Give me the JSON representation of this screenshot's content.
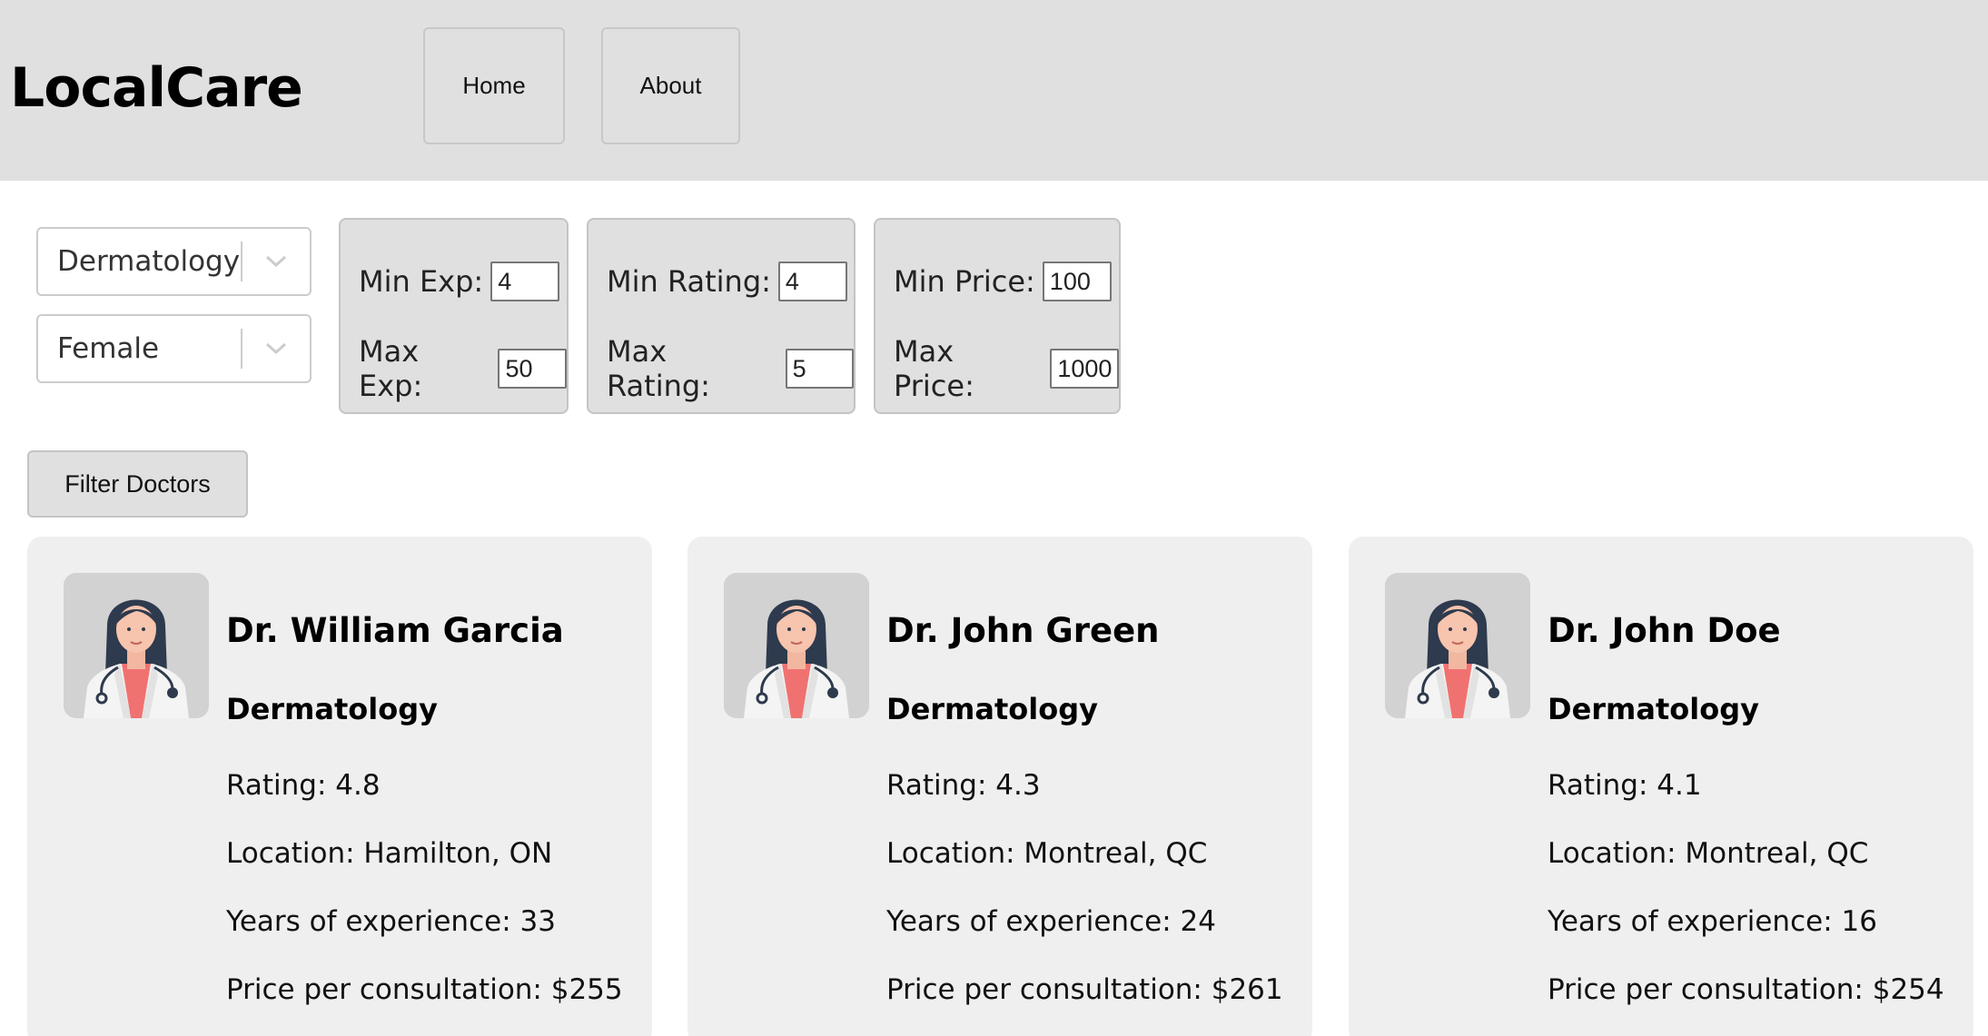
{
  "app": {
    "title": "LocalCare"
  },
  "nav": {
    "home": "Home",
    "about": "About"
  },
  "filters": {
    "specialty": "Dermatology",
    "gender": "Female",
    "exp": {
      "min_label": "Min Exp:",
      "min_value": "4",
      "max_label": "Max Exp:",
      "max_value": "50"
    },
    "rating": {
      "min_label": "Min Rating:",
      "min_value": "4",
      "max_label": "Max Rating:",
      "max_value": "5"
    },
    "price": {
      "min_label": "Min Price:",
      "min_value": "100",
      "max_label": "Max Price:",
      "max_value": "1000"
    },
    "button": "Filter Doctors"
  },
  "doctors": [
    {
      "name": "Dr. William Garcia",
      "specialty": "Dermatology",
      "rating": "Rating: 4.8",
      "location": "Location: Hamilton, ON",
      "experience": "Years of experience: 33",
      "price": "Price per consultation: $255"
    },
    {
      "name": "Dr. John Green",
      "specialty": "Dermatology",
      "rating": "Rating: 4.3",
      "location": "Location: Montreal, QC",
      "experience": "Years of experience: 24",
      "price": "Price per consultation: $261"
    },
    {
      "name": "Dr. John Doe",
      "specialty": "Dermatology",
      "rating": "Rating: 4.1",
      "location": "Location: Montreal, QC",
      "experience": "Years of experience: 16",
      "price": "Price per consultation: $254"
    }
  ],
  "icons": {
    "select_arrow": "chevron-down-icon",
    "avatar": "doctor-avatar-icon"
  },
  "colors": {
    "header_bg": "#e0e0e0",
    "card_bg": "#efefef"
  }
}
